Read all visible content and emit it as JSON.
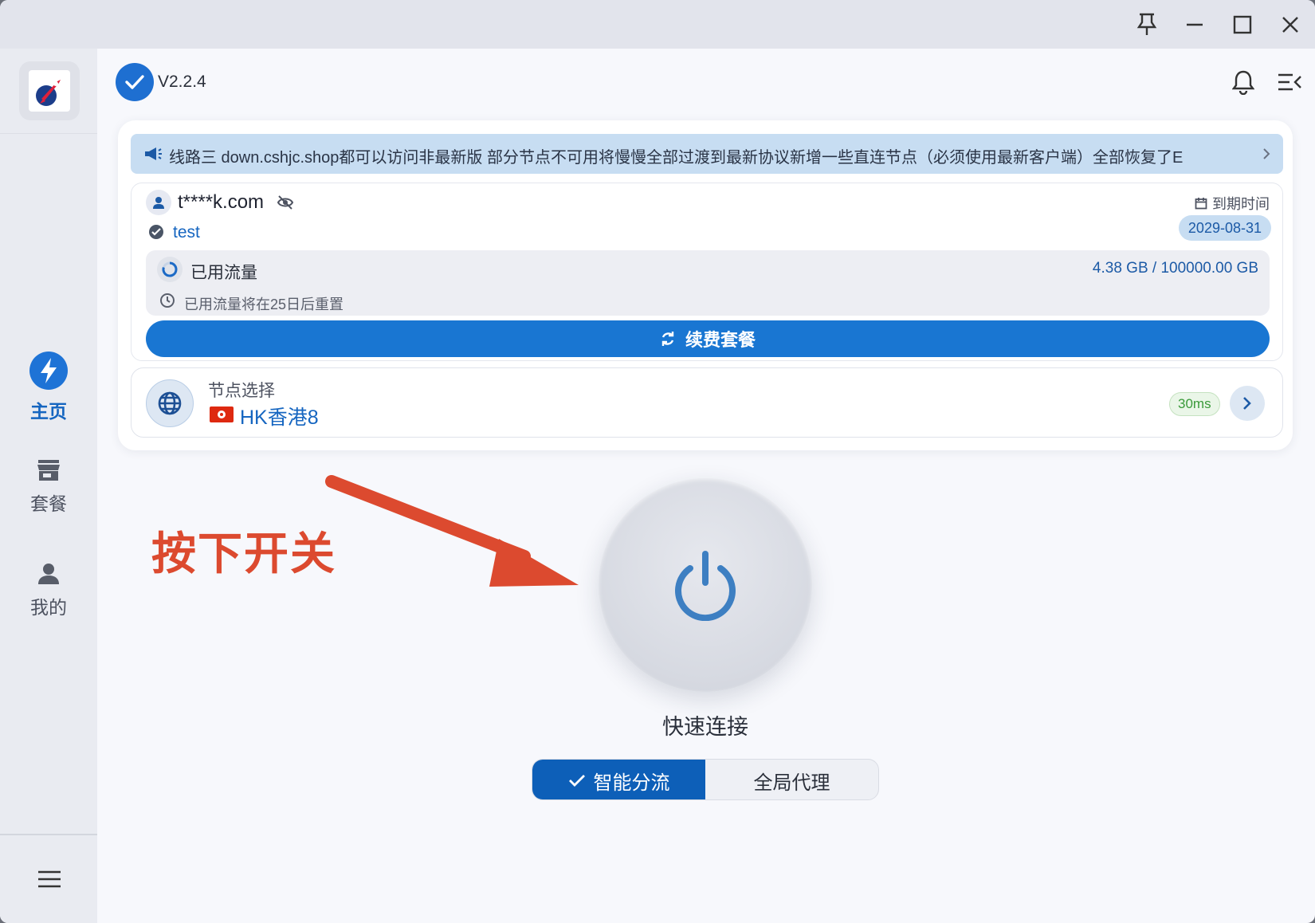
{
  "window": {
    "controls": [
      "pin-icon",
      "minimize-icon",
      "maximize-icon",
      "close-icon"
    ]
  },
  "sidebar": {
    "items": [
      {
        "label": "主页",
        "icon": "lightning-icon",
        "active": true
      },
      {
        "label": "套餐",
        "icon": "store-icon",
        "active": false
      },
      {
        "label": "我的",
        "icon": "person-icon",
        "active": false
      }
    ],
    "menu_icon": "hamburger-icon"
  },
  "header": {
    "version": "V2.2.4",
    "icons": [
      "bell-icon",
      "menu-collapse-icon"
    ]
  },
  "notice": {
    "text": "线路三 down.cshjc.shop都可以访问非最新版 部分节点不可用将慢慢全部过渡到最新协议新增一些直连节点（必须使用最新客户端）全部恢复了E"
  },
  "account": {
    "email": "t****k.com",
    "plan": "test",
    "expiry_label": "到期时间",
    "expiry_date": "2029-08-31",
    "traffic_label": "已用流量",
    "traffic_value": "4.38 GB / 100000.00 GB",
    "reset_text": "已用流量将在25日后重置",
    "renew_label": "续费套餐"
  },
  "node": {
    "caption": "节点选择",
    "name": "HK香港8",
    "latency": "30ms"
  },
  "connect": {
    "label": "快速连接",
    "modes": [
      "智能分流",
      "全局代理"
    ],
    "selected_mode": "智能分流"
  },
  "annotation": {
    "text": "按下开关"
  },
  "colors": {
    "accent": "#1976d2",
    "annotation": "#dc4a2f",
    "latency_green": "#3a9a3a"
  }
}
